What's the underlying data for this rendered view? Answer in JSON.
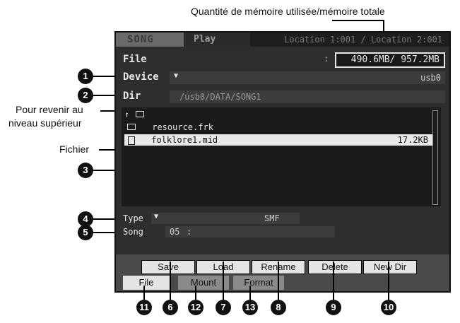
{
  "annotations": {
    "memory_label": "Quantité de mémoire utilisée/mémoire totale",
    "parent_label_line1": "Pour revenir au",
    "parent_label_line2": "niveau supérieur",
    "file_label": "Fichier"
  },
  "badges": [
    "1",
    "2",
    "3",
    "4",
    "5",
    "6",
    "7",
    "8",
    "9",
    "10",
    "11",
    "12",
    "13"
  ],
  "header": {
    "tab_song": "SONG",
    "tab_play": "Play",
    "location": "Location 1:001 / Location 2:001"
  },
  "screen": {
    "title": "File",
    "colon": ":",
    "memory": "490.6MB/  957.2MB",
    "device_label": "Device",
    "device_value": "usb0",
    "dir_label": "Dir",
    "dir_value": "/usb0/DATA/SONG1",
    "list": [
      {
        "name": "resource.frk",
        "icon": "folder-icon",
        "size": ""
      },
      {
        "name": "folklore1.mid",
        "icon": "file-icon",
        "size": "17.2KB"
      }
    ],
    "type_label": "Type",
    "type_value": "SMF",
    "song_label": "Song",
    "song_number": "05",
    "song_sep": ":"
  },
  "buttons": {
    "save": "Save",
    "load": "Load",
    "rename": "Rename",
    "delete": "Delete",
    "new_dir": "New Dir"
  },
  "tabs": {
    "file": "File",
    "mount": "Mount",
    "format": "Format"
  },
  "colors": {
    "screen_bg": "#2e2e2e",
    "selected_row": "#e8e8e8"
  }
}
